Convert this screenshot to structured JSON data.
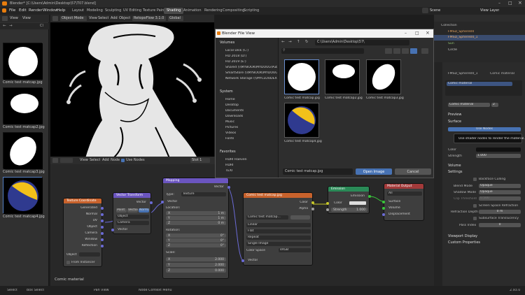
{
  "window": {
    "title": "Blender* [C:\\Users\\Admin\\Desktop\\57\\T07.blend]"
  },
  "menu": [
    "File",
    "Edit",
    "Render",
    "Window",
    "Help"
  ],
  "workspaces": [
    "Layout",
    "Modeling",
    "Sculpting",
    "UV Editing",
    "Texture Paint",
    "Shading",
    "Animation",
    "Rendering",
    "Compositing",
    "Scripting"
  ],
  "scene": {
    "label": "Scene",
    "view_layer": "View Layer"
  },
  "image_browser": {
    "header": [
      "View",
      "View",
      "Image"
    ],
    "items": [
      {
        "label": "Comic test matcap.jpg"
      },
      {
        "label": "Comic test matcap2.jpg"
      },
      {
        "label": "Comic test matcap3.jpg"
      },
      {
        "label": "Comic test matcap4.jpg"
      }
    ]
  },
  "viewport": {
    "mode": "Object Mode",
    "menus": [
      "View",
      "Select",
      "Add",
      "Object"
    ],
    "extra": "RetopoFlow 3.1.0",
    "shading": "Global"
  },
  "node_editor": {
    "menus": [
      "View",
      "Select",
      "Add",
      "Node"
    ],
    "use_nodes": "Use Nodes",
    "slot": "Slot 1",
    "material_label": "Comic material"
  },
  "nodes": {
    "texcoord": {
      "title": "Texture Coordinate",
      "outputs": [
        "Generated",
        "Normal",
        "UV",
        "Object",
        "Camera",
        "Window",
        "Reflection"
      ],
      "object": "Object",
      "from_instancer": "From Instancer"
    },
    "vector_transform": {
      "title": "Vector Transform",
      "modes": [
        "Point",
        "Vector",
        "Normal"
      ],
      "from": "Object",
      "to": "Camera",
      "out": "Vector",
      "in": "Vector"
    },
    "mapping": {
      "title": "Mapping",
      "out": "Vector",
      "type_label": "Type:",
      "type": "Texture",
      "vector": "Vector",
      "location": "Location:",
      "loc": [
        "1 m",
        "1 m",
        "0 m"
      ],
      "rotation": "Rotation:",
      "rot": [
        "0°",
        "0°",
        "0°"
      ],
      "scale": "Scale:",
      "scl": [
        "2.000",
        "2.000",
        "0.000"
      ],
      "axes": [
        "X",
        "Y",
        "Z"
      ]
    },
    "image": {
      "title": "Comic test matcap.jpg",
      "outputs": [
        "Color",
        "Alpha"
      ],
      "file": "Comic test matcap...",
      "interp": "Linear",
      "proj": "Flat",
      "ext": "Repeat",
      "source": "Single Image",
      "cs_label": "Color Space",
      "cs": "sRGB",
      "vector": "Vector"
    },
    "emission": {
      "title": "Emission",
      "out": "Emission",
      "color": "Color",
      "strength": "Strength",
      "strength_val": "1.000"
    },
    "output": {
      "title": "Material Output",
      "target": "All",
      "inputs": [
        "Surface",
        "Volume",
        "Displacement"
      ]
    }
  },
  "dialog": {
    "title": "Blender File View",
    "path": "C:\\Users\\Admin\\Desktop\\57\\",
    "volumes_title": "Volumes",
    "volumes": [
      "Local Disk (C:)",
      "HD 2018 (D:)",
      "HD 2019 (E:)",
      "Shared (\\\\MYBOOK\\MYDOUG\\Public) (...",
      "SmartStore (\\\\MYBOOK\\MYDOUG) (X:)",
      "Network Storage (\\\\MYCLOUDEX2ULTRA\\..."
    ],
    "system_title": "System",
    "system": [
      "Home",
      "Desktop",
      "Documents",
      "Downloads",
      "Music",
      "Pictures",
      "Videos",
      "Fonts"
    ],
    "favorites_title": "Favorites",
    "favorites": [
      "HDRI Haeven",
      "HDRI",
      "TEXI"
    ],
    "files": [
      "Comic test matcap.jpg",
      "Comic test matcap2.jpg",
      "Comic test matcap3.jpg",
      "Comic test matcap4.jpg"
    ],
    "filename": "Comic test matcap.jpg",
    "open": "Open Image",
    "cancel": "Cancel"
  },
  "outliner": {
    "collection": "Collection",
    "items": [
      "FMSD_Sphere00",
      "FMSD_Sphere00_1",
      "Sun",
      "Circle"
    ]
  },
  "properties": {
    "object": "FMSD_Sphere00_1",
    "material_tab": "Comic material",
    "slot": "Comic material",
    "slot_count": "2",
    "preview": "Preview",
    "surface": "Surface",
    "use_nodes": "Use Nodes",
    "tooltip": "Use shader nodes to render the material.",
    "color": "Color",
    "strength": "Strength",
    "strength_val": "1.000",
    "volume": "Volume",
    "settings": "Settings",
    "backface": "Backface Culling",
    "blend_mode_label": "Blend Mode",
    "blend_mode": "Opaque",
    "shadow_label": "Shadow Mode",
    "shadow": "Opaque",
    "clip_label": "Clip Threshold",
    "clip": "0.500",
    "ssr": "Screen Space Refraction",
    "refr_label": "Refraction Depth",
    "refr": "0 m",
    "sss": "Subsurface Translucency",
    "pass_label": "Pass Index",
    "pass": "0",
    "viewport_display": "Viewport Display",
    "custom": "Custom Properties"
  },
  "status": {
    "select": "Select",
    "box": "Box Select",
    "pan": "Pan View",
    "ctx": "Node Context Menu",
    "version": "2.93.0"
  },
  "colors": {
    "accent": "#4772b3",
    "emission_head": "#2a8a57",
    "output_head": "#a33a3a",
    "image_head": "#c8622c",
    "vector_head": "#6b55c0",
    "input_head": "#c8622c"
  }
}
